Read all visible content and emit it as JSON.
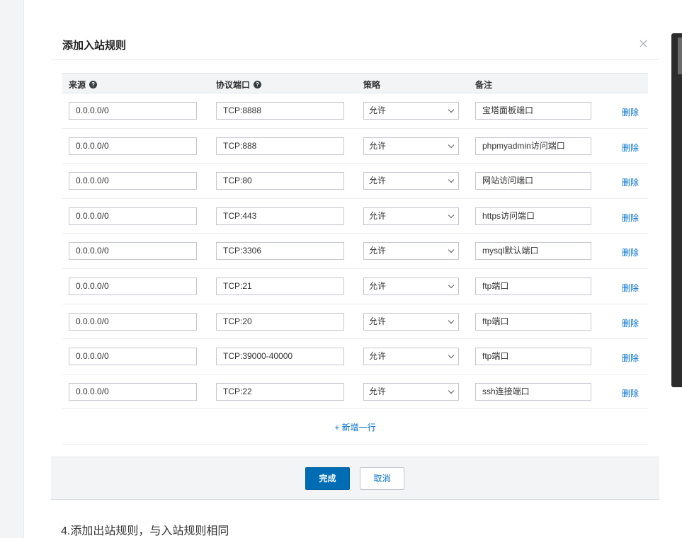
{
  "dialog": {
    "title": "添加入站规则",
    "columns": {
      "source": "来源",
      "port": "协议端口",
      "policy": "策略",
      "note": "备注"
    },
    "help_glyph": "?",
    "rules": [
      {
        "source": "0.0.0.0/0",
        "port": "TCP:8888",
        "policy": "允许",
        "note": "宝塔面板端口",
        "delete": "删除"
      },
      {
        "source": "0.0.0.0/0",
        "port": "TCP:888",
        "policy": "允许",
        "note": "phpmyadmin访问端口",
        "delete": "删除"
      },
      {
        "source": "0.0.0.0/0",
        "port": "TCP:80",
        "policy": "允许",
        "note": "网站访问端口",
        "delete": "删除"
      },
      {
        "source": "0.0.0.0/0",
        "port": "TCP:443",
        "policy": "允许",
        "note": "https访问端口",
        "delete": "删除"
      },
      {
        "source": "0.0.0.0/0",
        "port": "TCP:3306",
        "policy": "允许",
        "note": "mysql默认端口",
        "delete": "删除"
      },
      {
        "source": "0.0.0.0/0",
        "port": "TCP:21",
        "policy": "允许",
        "note": "ftp端口",
        "delete": "删除"
      },
      {
        "source": "0.0.0.0/0",
        "port": "TCP:20",
        "policy": "允许",
        "note": "ftp端口",
        "delete": "删除"
      },
      {
        "source": "0.0.0.0/0",
        "port": "TCP:39000-40000",
        "policy": "允许",
        "note": "ftp端口",
        "delete": "删除"
      },
      {
        "source": "0.0.0.0/0",
        "port": "TCP:22",
        "policy": "允许",
        "note": "ssh连接端口",
        "delete": "删除"
      }
    ],
    "add_row_label": "+ 新增一行",
    "confirm_label": "完成",
    "cancel_label": "取消"
  },
  "doc": {
    "step_text": "4.添加出站规则，与入站规则相同"
  },
  "colors": {
    "primary": "#006cb3",
    "link": "#0070cc",
    "header_bg": "#f2f4f6",
    "border": "#c4c6cf"
  },
  "icons": {
    "close": "close-icon",
    "help": "help-icon",
    "dropdown": "chevron-down-icon"
  }
}
